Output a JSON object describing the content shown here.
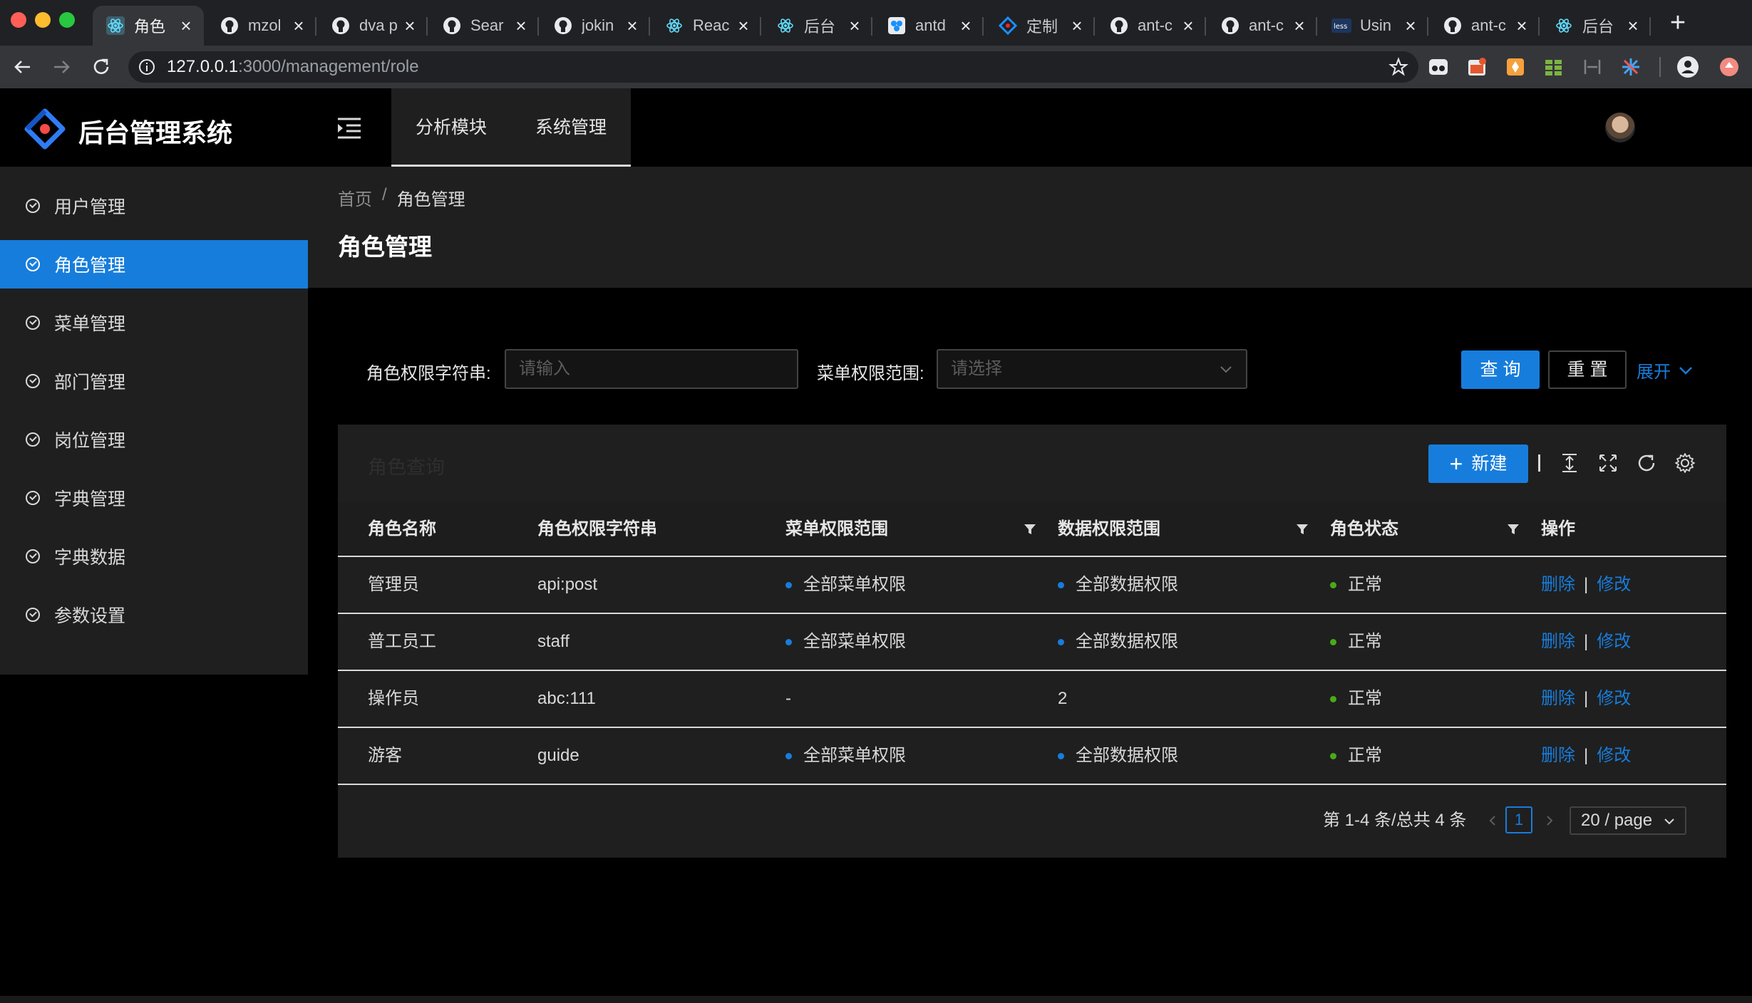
{
  "browser": {
    "tabs": [
      {
        "title": "角色",
        "icon": "react-icon",
        "active": true
      },
      {
        "title": "mzol",
        "icon": "github-icon"
      },
      {
        "title": "dva p",
        "icon": "github-icon"
      },
      {
        "title": "Sear",
        "icon": "github-icon"
      },
      {
        "title": "jokin",
        "icon": "github-icon"
      },
      {
        "title": "Reac",
        "icon": "react-icon"
      },
      {
        "title": "后台",
        "icon": "react-icon"
      },
      {
        "title": "antd",
        "icon": "antd-pro-icon"
      },
      {
        "title": "定制",
        "icon": "antd-logo-icon"
      },
      {
        "title": "ant-c",
        "icon": "github-icon"
      },
      {
        "title": "ant-c",
        "icon": "github-icon"
      },
      {
        "title": "Usin",
        "icon": "less-icon"
      },
      {
        "title": "ant-c",
        "icon": "github-icon"
      },
      {
        "title": "后台",
        "icon": "react-icon"
      }
    ],
    "url_host": "127.0.0.1",
    "url_path": ":3000/management/role"
  },
  "header": {
    "app_title": "后台管理系统",
    "top_menu": [
      "分析模块",
      "系统管理"
    ]
  },
  "sidebar": {
    "items": [
      {
        "label": "用户管理"
      },
      {
        "label": "角色管理",
        "active": true
      },
      {
        "label": "菜单管理"
      },
      {
        "label": "部门管理"
      },
      {
        "label": "岗位管理"
      },
      {
        "label": "字典管理"
      },
      {
        "label": "字典数据"
      },
      {
        "label": "参数设置"
      }
    ]
  },
  "page": {
    "breadcrumb": [
      "首页",
      "/",
      "角色管理"
    ],
    "title": "角色管理"
  },
  "search": {
    "role_key_label": "角色权限字符串:",
    "role_key_placeholder": "请输入",
    "menu_scope_label": "菜单权限范围:",
    "menu_scope_placeholder": "请选择",
    "query_button": "查 询",
    "reset_button": "重 置",
    "expand_link": "展开"
  },
  "table": {
    "title": "角色查询",
    "new_button": "新建",
    "columns": [
      "角色名称",
      "角色权限字符串",
      "菜单权限范围",
      "数据权限范围",
      "角色状态",
      "操作"
    ],
    "rows": [
      {
        "name": "管理员",
        "key": "api:post",
        "menu_scope": "全部菜单权限",
        "data_scope": "全部数据权限",
        "status": "正常",
        "delete": "删除",
        "edit": "修改"
      },
      {
        "name": "普工员工",
        "key": "staff",
        "menu_scope": "全部菜单权限",
        "data_scope": "全部数据权限",
        "status": "正常",
        "delete": "删除",
        "edit": "修改"
      },
      {
        "name": "操作员",
        "key": "abc:111",
        "menu_scope": "-",
        "data_scope": "2",
        "status": "正常",
        "delete": "删除",
        "edit": "修改"
      },
      {
        "name": "游客",
        "key": "guide",
        "menu_scope": "全部菜单权限",
        "data_scope": "全部数据权限",
        "status": "正常",
        "delete": "删除",
        "edit": "修改"
      }
    ],
    "pagination": {
      "total_text": "第 1-4 条/总共 4 条",
      "current_page": "1",
      "page_size": "20 / page"
    }
  },
  "colors": {
    "primary": "#177ddc",
    "status_normal": "#49aa19",
    "scope_dot": "#177ddc"
  }
}
